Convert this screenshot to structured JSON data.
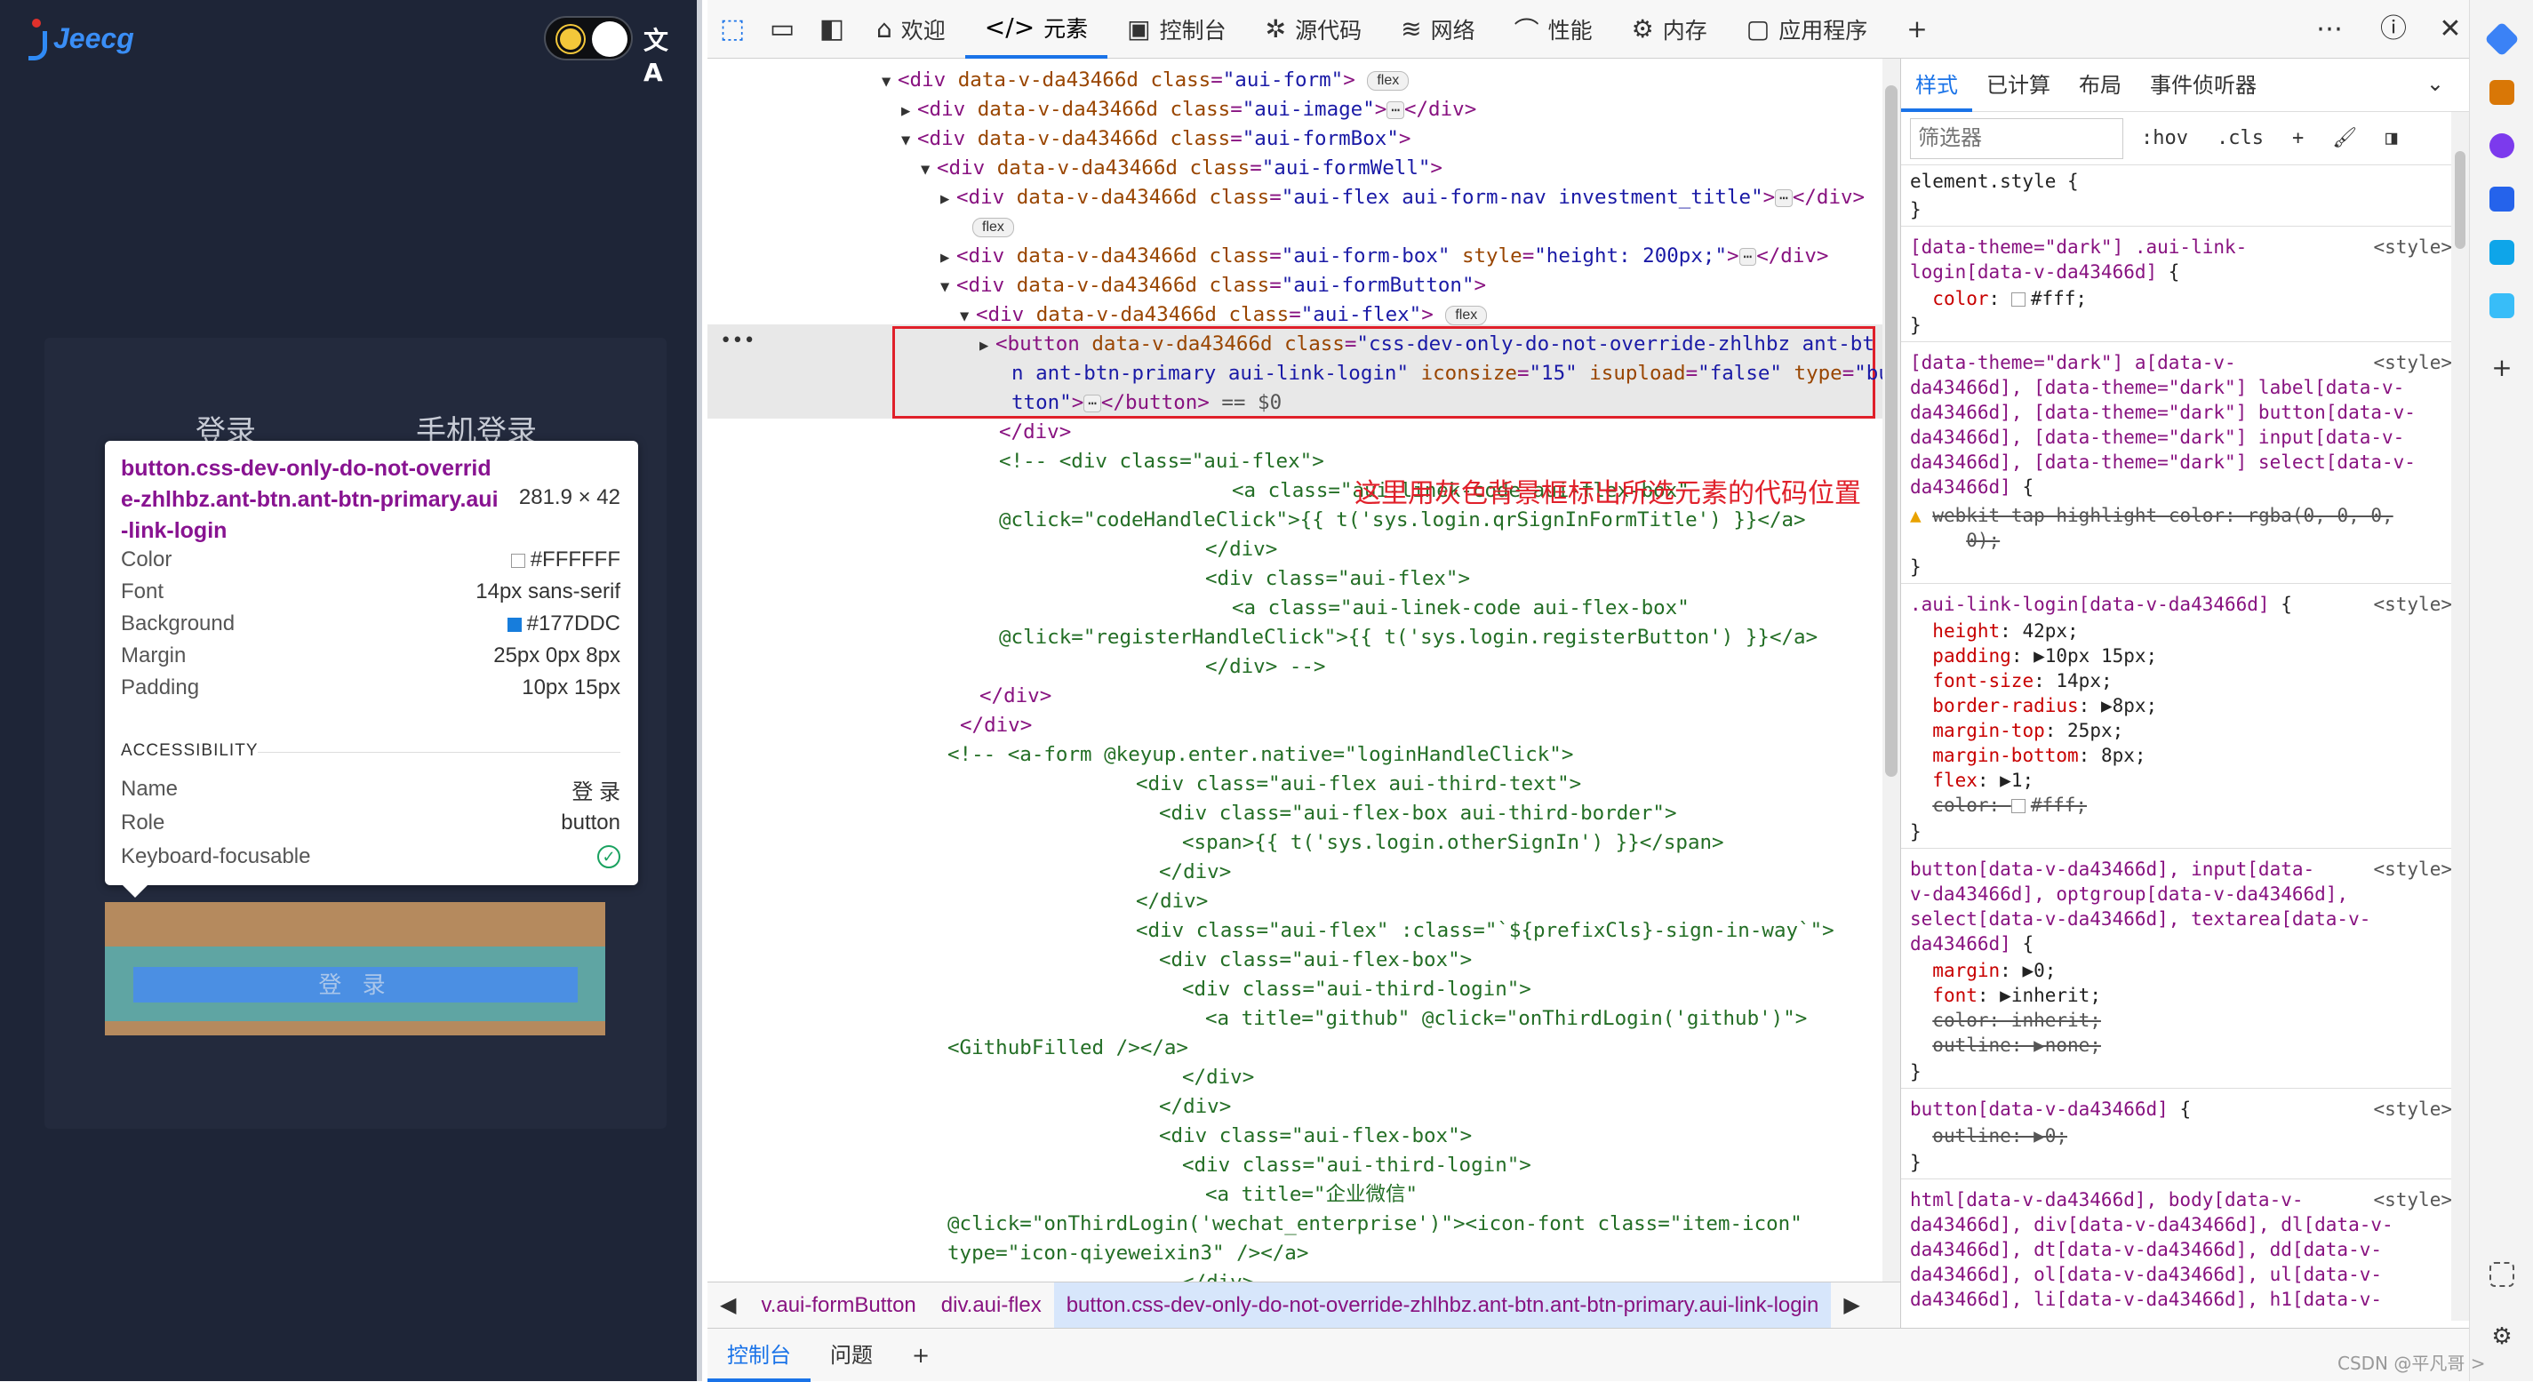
{
  "preview": {
    "logo_text": "Jeecg",
    "lang_icon": "文A",
    "tab_login": "登录",
    "tab_phone": "手机登录",
    "login_button": "登 录",
    "tooltip": {
      "selector": "button.css-dev-only-do-not-override-zhlhbz.ant-btn.ant-btn-primary.aui-link-login",
      "size": "281.9 × 42",
      "rows": [
        {
          "k": "Color",
          "v": "#FFFFFF",
          "swatch": "#FFFFFF"
        },
        {
          "k": "Font",
          "v": "14px sans-serif"
        },
        {
          "k": "Background",
          "v": "#177DDC",
          "swatch": "#177DDC"
        },
        {
          "k": "Margin",
          "v": "25px 0px 8px"
        },
        {
          "k": "Padding",
          "v": "10px 15px"
        }
      ],
      "accessibility_title": "ACCESSIBILITY",
      "acc_rows": [
        {
          "k": "Name",
          "v": "登 录"
        },
        {
          "k": "Role",
          "v": "button"
        },
        {
          "k": "Keyboard-focusable",
          "v": ""
        }
      ]
    }
  },
  "devtools": {
    "tabs": [
      {
        "icon": "⌂",
        "label": "欢迎"
      },
      {
        "icon": "</>",
        "label": "元素",
        "active": true
      },
      {
        "icon": "▣",
        "label": "控制台"
      },
      {
        "icon": "✲",
        "label": "源代码"
      },
      {
        "icon": "≋",
        "label": "网络"
      },
      {
        "icon": "⌒",
        "label": "性能"
      },
      {
        "icon": "⚙",
        "label": "内存"
      },
      {
        "icon": "▢",
        "label": "应用程序"
      },
      {
        "icon": "+",
        "label": ""
      }
    ],
    "annotation": "这里用灰色背景框标出所选元素的代码位置",
    "breadcrumbs": [
      "v.aui-formButton",
      "div.aui-flex",
      "button.css-dev-only-do-not-override-zhlhbz.ant-btn.ant-btn-primary.aui-link-login"
    ],
    "drawer_tabs": [
      "控制台",
      "问题",
      "+"
    ],
    "styles_tabs": [
      "样式",
      "已计算",
      "布局",
      "事件侦听器"
    ],
    "filter_placeholder": "筛选器",
    "filter_buttons": [
      ":hov",
      ".cls"
    ],
    "watermark": "CSDN @平凡哥 >"
  }
}
